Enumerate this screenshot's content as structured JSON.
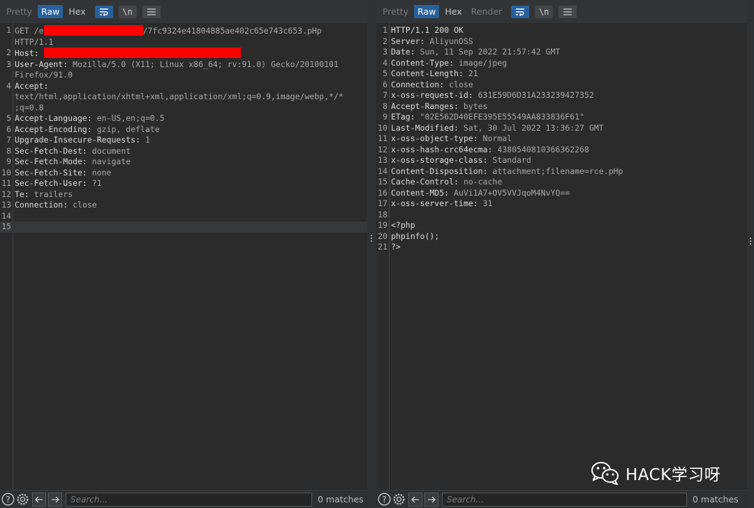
{
  "colors": {
    "accent": "#27619d",
    "redaction": "#ff0000",
    "background": "#2b2b2b"
  },
  "request": {
    "tabs": [
      "Pretty",
      "Raw",
      "Hex"
    ],
    "active_tab": "Raw",
    "wrap_icon": "wrap-lines-icon",
    "newline_toggle_label": "\\n",
    "menu_icon": "hamburger-menu-icon",
    "lines": [
      {
        "n": "1",
        "parts": [
          {
            "t": "GET /",
            "k": "v"
          },
          {
            "t": "e",
            "k": "v"
          },
          {
            "t": "",
            "k": "redact",
            "w": 142
          },
          {
            "t": "/7fc9324e41804885ae402c65e743c653.pHp",
            "k": "v"
          }
        ],
        "wrap": "HTTP/1.1"
      },
      {
        "n": "2",
        "parts": [
          {
            "t": "Host:",
            "k": "h"
          },
          {
            "t": " ",
            "k": "v"
          },
          {
            "t": "",
            "k": "redact",
            "w": 282
          }
        ]
      },
      {
        "n": "3",
        "parts": [
          {
            "t": "User-Agent:",
            "k": "h"
          },
          {
            "t": " Mozilla/5.0 (X11; Linux x86_64; rv:91.0) Gecko/20100101",
            "k": "v"
          }
        ],
        "wrap": "Firefox/91.0"
      },
      {
        "n": "4",
        "parts": [
          {
            "t": "Accept:",
            "k": "h"
          }
        ],
        "wrap": "text/html,application/xhtml+xml,application/xml;q=0.9,image/webp,*/*",
        "wrap2": ";q=0.8"
      },
      {
        "n": "5",
        "parts": [
          {
            "t": "Accept-Language:",
            "k": "h"
          },
          {
            "t": " en-US,en;q=0.5",
            "k": "v"
          }
        ]
      },
      {
        "n": "6",
        "parts": [
          {
            "t": "Accept-Encoding:",
            "k": "h"
          },
          {
            "t": " gzip, deflate",
            "k": "v"
          }
        ]
      },
      {
        "n": "7",
        "parts": [
          {
            "t": "Upgrade-Insecure-Requests:",
            "k": "h"
          },
          {
            "t": " 1",
            "k": "v"
          }
        ]
      },
      {
        "n": "8",
        "parts": [
          {
            "t": "Sec-Fetch-Dest:",
            "k": "h"
          },
          {
            "t": " document",
            "k": "v"
          }
        ]
      },
      {
        "n": "9",
        "parts": [
          {
            "t": "Sec-Fetch-Mode:",
            "k": "h"
          },
          {
            "t": " navigate",
            "k": "v"
          }
        ]
      },
      {
        "n": "10",
        "parts": [
          {
            "t": "Sec-Fetch-Site:",
            "k": "h"
          },
          {
            "t": " none",
            "k": "v"
          }
        ]
      },
      {
        "n": "11",
        "parts": [
          {
            "t": "Sec-Fetch-User:",
            "k": "h"
          },
          {
            "t": " ?1",
            "k": "v"
          }
        ]
      },
      {
        "n": "12",
        "parts": [
          {
            "t": "Te:",
            "k": "h"
          },
          {
            "t": " trailers",
            "k": "v"
          }
        ]
      },
      {
        "n": "13",
        "parts": [
          {
            "t": "Connection:",
            "k": "h"
          },
          {
            "t": " close",
            "k": "v"
          }
        ]
      },
      {
        "n": "14",
        "parts": []
      },
      {
        "n": "15",
        "parts": [],
        "current": true
      }
    ],
    "search_placeholder": "Search...",
    "matches": "0 matches"
  },
  "response": {
    "tabs": [
      "Pretty",
      "Raw",
      "Hex",
      "Render"
    ],
    "active_tab": "Raw",
    "wrap_icon": "wrap-lines-icon",
    "newline_toggle_label": "\\n",
    "menu_icon": "hamburger-menu-icon",
    "lines": [
      {
        "n": "1",
        "parts": [
          {
            "t": "HTTP/1.1 200 OK",
            "k": "h"
          }
        ]
      },
      {
        "n": "2",
        "parts": [
          {
            "t": "Server:",
            "k": "h"
          },
          {
            "t": " AliyunOSS",
            "k": "v"
          }
        ]
      },
      {
        "n": "3",
        "parts": [
          {
            "t": "Date:",
            "k": "h"
          },
          {
            "t": " Sun, 11 Sep 2022 21:57:42 GMT",
            "k": "v"
          }
        ]
      },
      {
        "n": "4",
        "parts": [
          {
            "t": "Content-Type:",
            "k": "h"
          },
          {
            "t": " image/jpeg",
            "k": "v"
          }
        ]
      },
      {
        "n": "5",
        "parts": [
          {
            "t": "Content-Length:",
            "k": "h"
          },
          {
            "t": " 21",
            "k": "v"
          }
        ]
      },
      {
        "n": "6",
        "parts": [
          {
            "t": "Connection:",
            "k": "h"
          },
          {
            "t": " close",
            "k": "v"
          }
        ]
      },
      {
        "n": "7",
        "parts": [
          {
            "t": "x-oss-request-id:",
            "k": "h"
          },
          {
            "t": " 631E59D6D31A233239427352",
            "k": "v"
          }
        ]
      },
      {
        "n": "8",
        "parts": [
          {
            "t": "Accept-Ranges:",
            "k": "h"
          },
          {
            "t": " bytes",
            "k": "v"
          }
        ]
      },
      {
        "n": "9",
        "parts": [
          {
            "t": "ETag:",
            "k": "h"
          },
          {
            "t": " \"02E562D40EFE395E55549AA833836F61\"",
            "k": "v"
          }
        ]
      },
      {
        "n": "10",
        "parts": [
          {
            "t": "Last-Modified:",
            "k": "h"
          },
          {
            "t": " Sat, 30 Jul 2022 13:36:27 GMT",
            "k": "v"
          }
        ]
      },
      {
        "n": "11",
        "parts": [
          {
            "t": "x-oss-object-type:",
            "k": "h"
          },
          {
            "t": " Normal",
            "k": "v"
          }
        ]
      },
      {
        "n": "12",
        "parts": [
          {
            "t": "x-oss-hash-crc64ecma:",
            "k": "h"
          },
          {
            "t": " 4380540810366362268",
            "k": "v"
          }
        ]
      },
      {
        "n": "13",
        "parts": [
          {
            "t": "x-oss-storage-class:",
            "k": "h"
          },
          {
            "t": " Standard",
            "k": "v"
          }
        ]
      },
      {
        "n": "14",
        "parts": [
          {
            "t": "Content-Disposition:",
            "k": "h"
          },
          {
            "t": " attachment;filename=rce.pHp",
            "k": "v"
          }
        ]
      },
      {
        "n": "15",
        "parts": [
          {
            "t": "Cache-Control:",
            "k": "h"
          },
          {
            "t": " no-cache",
            "k": "v"
          }
        ]
      },
      {
        "n": "16",
        "parts": [
          {
            "t": "Content-MD5:",
            "k": "h"
          },
          {
            "t": " AuVi1A7+OV5VVJqoM4NvYQ==",
            "k": "v"
          }
        ]
      },
      {
        "n": "17",
        "parts": [
          {
            "t": "x-oss-server-time:",
            "k": "h"
          },
          {
            "t": " 31",
            "k": "v"
          }
        ]
      },
      {
        "n": "18",
        "parts": []
      },
      {
        "n": "19",
        "parts": [
          {
            "t": "<?php",
            "k": "h"
          }
        ]
      },
      {
        "n": "20",
        "parts": [
          {
            "t": "phpinfo();",
            "k": "h"
          }
        ]
      },
      {
        "n": "21",
        "parts": [
          {
            "t": "?>",
            "k": "h"
          }
        ]
      }
    ],
    "search_placeholder": "Search...",
    "matches": "0 matches"
  },
  "watermark": {
    "icon": "wechat-icon",
    "text": "HACK学习呀"
  }
}
